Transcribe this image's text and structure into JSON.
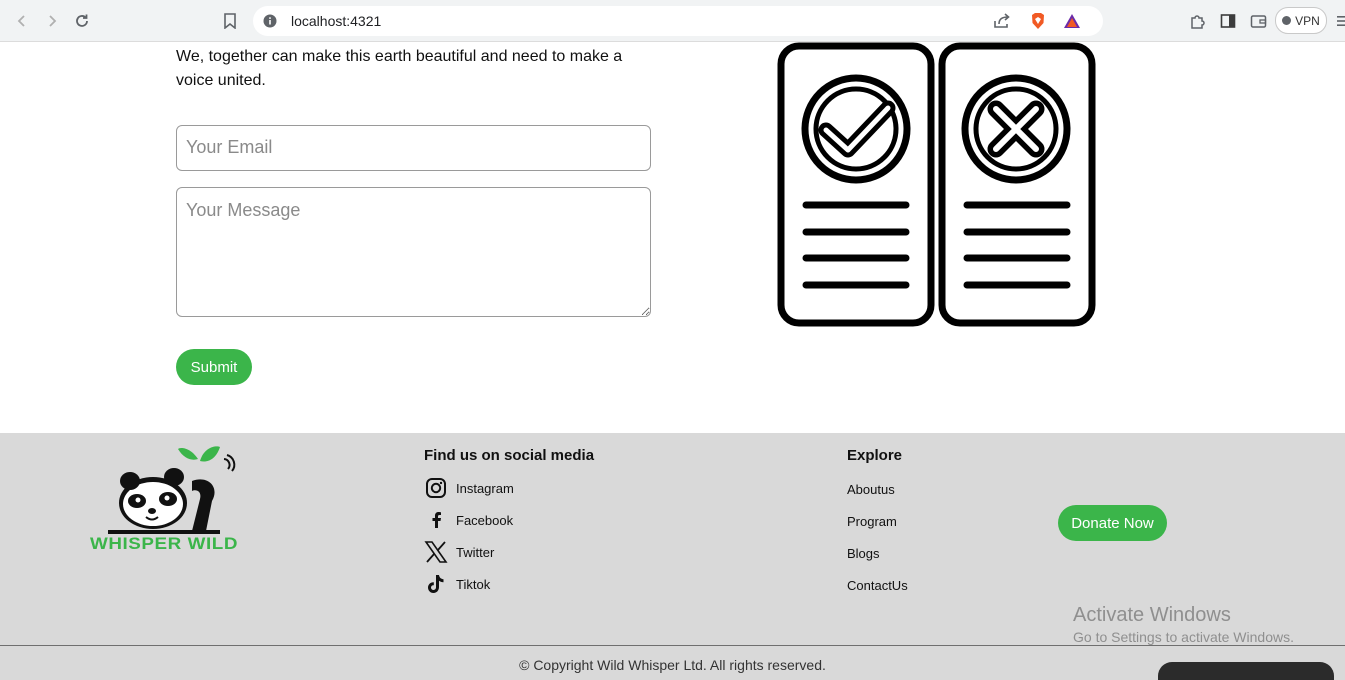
{
  "browser": {
    "url": "localhost:4321",
    "vpn_label": "VPN"
  },
  "contact": {
    "intro": "We, together can make this earth beautiful and need to make a voice united.",
    "email_placeholder": "Your Email",
    "message_placeholder": "Your Message",
    "submit_label": "Submit"
  },
  "footer": {
    "logo_text": "WHISPER WILD",
    "social_title": "Find us on social media",
    "social_links": [
      {
        "label": "Instagram",
        "icon": "instagram-icon"
      },
      {
        "label": "Facebook",
        "icon": "facebook-icon"
      },
      {
        "label": "Twitter",
        "icon": "x-twitter-icon"
      },
      {
        "label": "Tiktok",
        "icon": "tiktok-icon"
      }
    ],
    "explore_title": "Explore",
    "explore_links": [
      "Aboutus",
      "Program",
      "Blogs",
      "ContactUs"
    ],
    "donate_label": "Donate Now",
    "copyright": "© Copyright Wild Whisper Ltd. All rights reserved."
  },
  "overlay": {
    "activate_title": "Activate Windows",
    "activate_subtitle": "Go to Settings to activate Windows."
  },
  "colors": {
    "accent_green": "#3bb54a",
    "footer_bg": "#d9d9d9"
  }
}
